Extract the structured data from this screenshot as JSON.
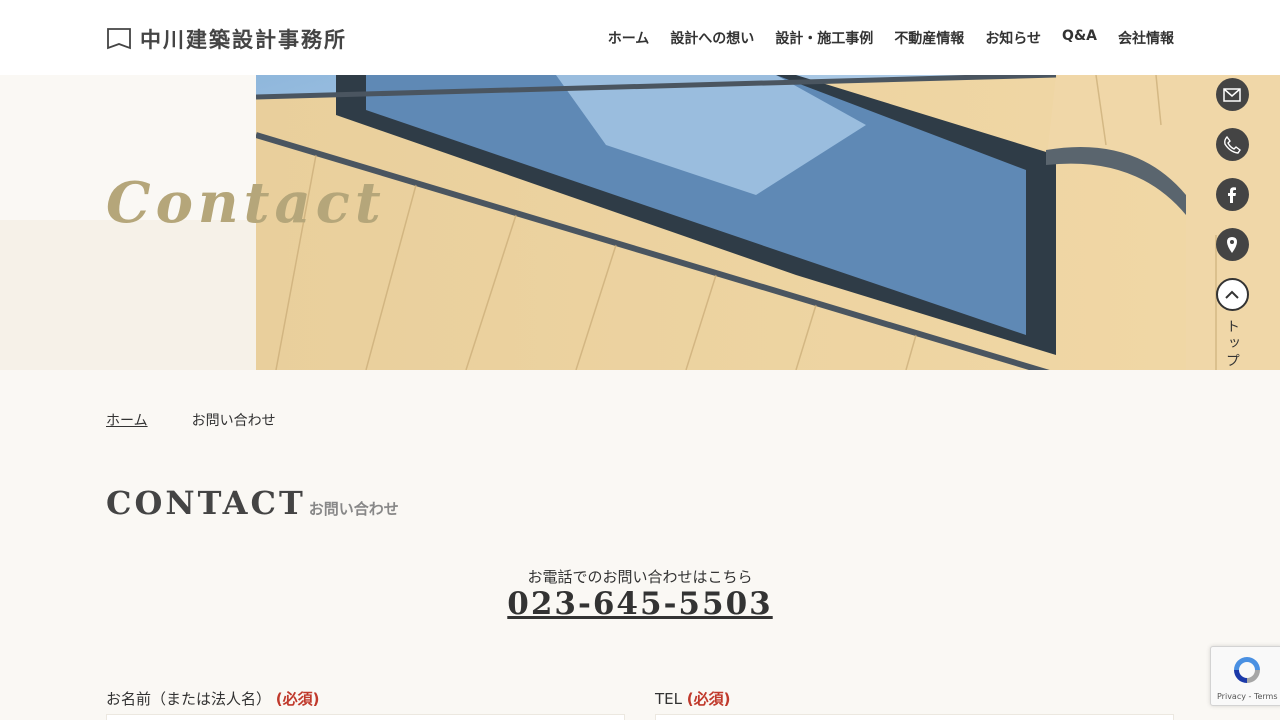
{
  "site": {
    "logo_text": "中川建築設計事務所"
  },
  "nav": [
    "ホーム",
    "設計への想い",
    "設計・施工事例",
    "不動産情報",
    "お知らせ",
    "Q&A",
    "会社情報"
  ],
  "hero": {
    "title": "Contact"
  },
  "side_buttons": [
    "mail-icon",
    "phone-icon",
    "facebook-icon",
    "map-pin-icon"
  ],
  "to_top": {
    "label": "トップ"
  },
  "breadcrumb": {
    "home": "ホーム",
    "current": "お問い合わせ"
  },
  "section": {
    "title_en": "CONTACT",
    "title_ja": "お問い合わせ"
  },
  "phone": {
    "label": "お電話でのお問い合わせはこちら",
    "number": "023-645-5503"
  },
  "form": {
    "name_label": "お名前（または法人名）",
    "tel_label": "TEL",
    "required": "(必須)"
  },
  "recaptcha": {
    "links": "Privacy - Terms"
  },
  "colors": {
    "accent_gold": "#b5a67a",
    "required_red": "#c0392b",
    "bg": "#faf8f4"
  }
}
